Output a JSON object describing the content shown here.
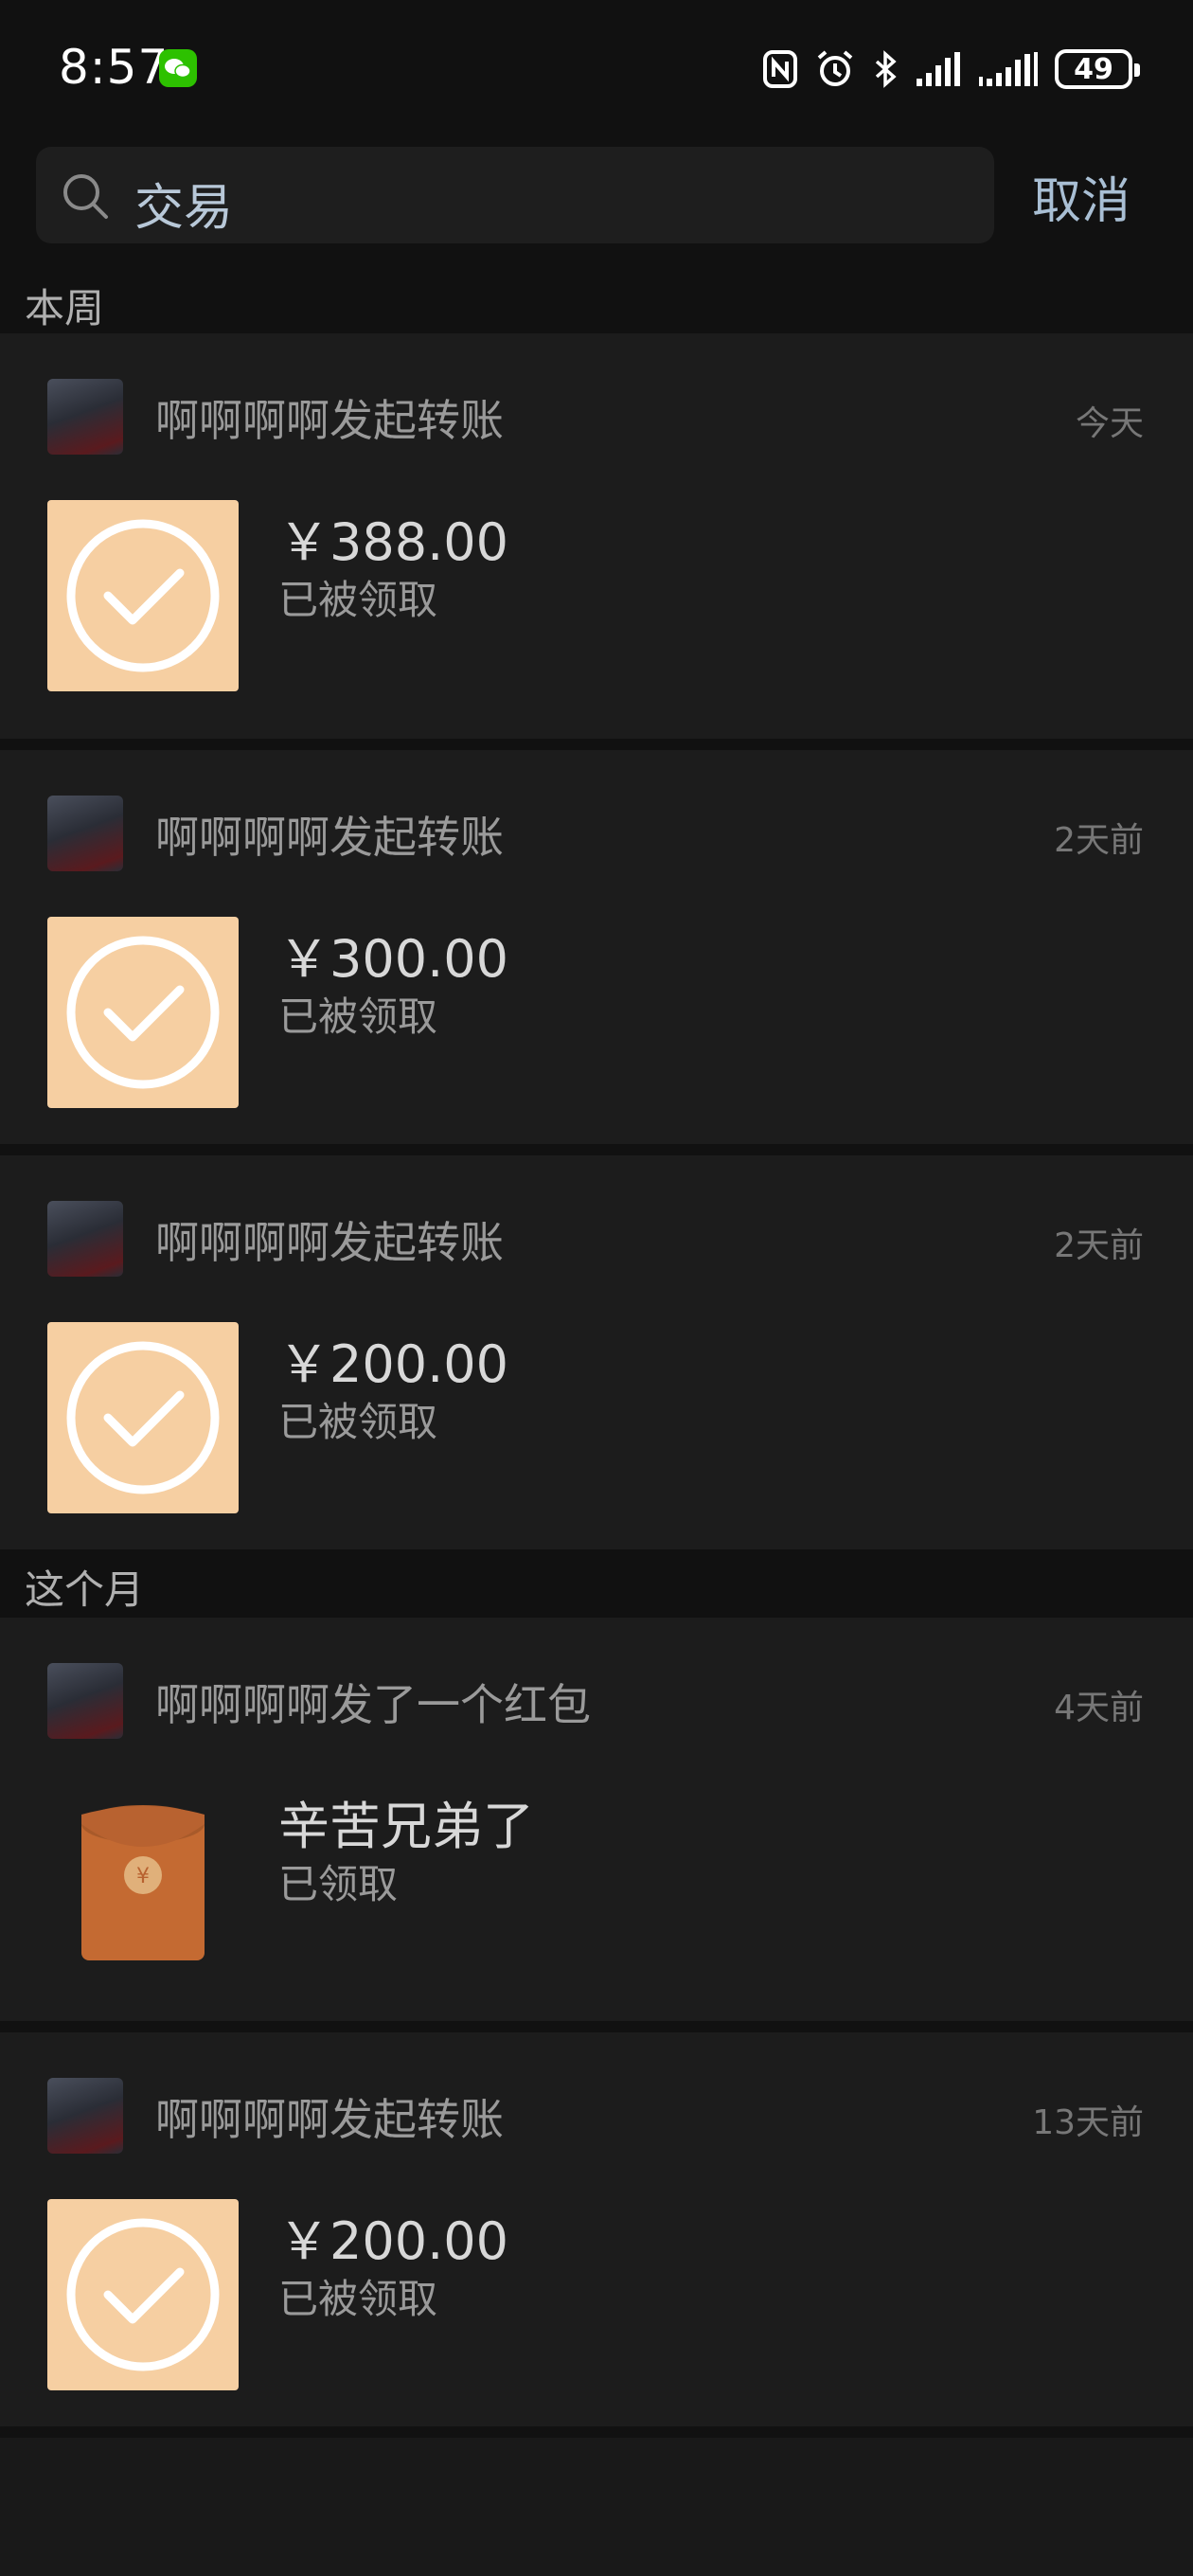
{
  "status_bar": {
    "time": "8:57",
    "battery": "49",
    "icons": [
      "wechat-icon",
      "nfc-icon",
      "alarm-icon",
      "bluetooth-icon",
      "signal-icon",
      "signal-2-icon",
      "battery-icon"
    ]
  },
  "search": {
    "query": "交易",
    "cancel_label": "取消"
  },
  "sections": [
    {
      "title": "本周"
    },
    {
      "title": "这个月"
    }
  ],
  "records": [
    {
      "type": "transfer",
      "title": "啊啊啊啊发起转账",
      "time": "今天",
      "amount": "￥388.00",
      "status": "已被领取"
    },
    {
      "type": "transfer",
      "title": "啊啊啊啊发起转账",
      "time": "2天前",
      "amount": "￥300.00",
      "status": "已被领取"
    },
    {
      "type": "transfer",
      "title": "啊啊啊啊发起转账",
      "time": "2天前",
      "amount": "￥200.00",
      "status": "已被领取"
    },
    {
      "type": "red_packet",
      "title": "啊啊啊啊发了一个红包",
      "time": "4天前",
      "amount": "辛苦兄弟了",
      "status": "已领取"
    },
    {
      "type": "transfer",
      "title": "啊啊啊啊发起转账",
      "time": "13天前",
      "amount": "￥200.00",
      "status": "已被领取"
    }
  ],
  "colors": {
    "background": "#111111",
    "card": "#1c1c1c",
    "transfer_tile": "#f6cfa2",
    "red_packet": "#c46a32",
    "link": "#a9bfd4"
  }
}
